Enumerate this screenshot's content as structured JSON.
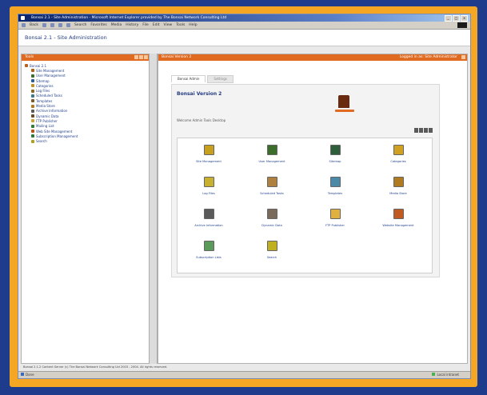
{
  "window": {
    "title": "Bonsai 2.1 - Site Administration - Microsoft Internet Explorer provided by The Bonsai Network Consulting Ltd",
    "controls": [
      "_",
      "□",
      "×"
    ]
  },
  "menubar": {
    "items": [
      "Back",
      "Forward",
      "Stop",
      "Refresh",
      "Home",
      "Search",
      "Favorites",
      "Media",
      "History",
      "File",
      "Edit",
      "View",
      "Favorites",
      "Tools",
      "Help"
    ]
  },
  "page": {
    "heading": "Bonsai 2.1 - Site Administration"
  },
  "left_pane": {
    "title": "Tools",
    "tree": [
      {
        "label": "Bonsai 2.1",
        "level": 0,
        "color": "#c06018"
      },
      {
        "label": "Site Management",
        "level": 1,
        "color": "#b06010"
      },
      {
        "label": "User Management",
        "level": 1,
        "color": "#3a6e2a"
      },
      {
        "label": "Sitemap",
        "level": 1,
        "color": "#2a5e9a"
      },
      {
        "label": "Categories",
        "level": 1,
        "color": "#c09020"
      },
      {
        "label": "Log Files",
        "level": 1,
        "color": "#8a6a20"
      },
      {
        "label": "Scheduled Tasks",
        "level": 1,
        "color": "#3a7a8a"
      },
      {
        "label": "Templates",
        "level": 1,
        "color": "#7a5a2a"
      },
      {
        "label": "Media Store",
        "level": 1,
        "color": "#b07a20"
      },
      {
        "label": "Archive Information",
        "level": 1,
        "color": "#5a5a5a"
      },
      {
        "label": "Dynamic Data",
        "level": 1,
        "color": "#6a4a2a"
      },
      {
        "label": "FTP Publisher",
        "level": 1,
        "color": "#d0a030"
      },
      {
        "label": "Mailing List",
        "level": 1,
        "color": "#2e7d32"
      },
      {
        "label": "Web Site Management",
        "level": 1,
        "color": "#c05010"
      },
      {
        "label": "Subscription Management",
        "level": 1,
        "color": "#2a7a3a"
      },
      {
        "label": "Search",
        "level": 1,
        "color": "#b0a020"
      }
    ]
  },
  "right_pane": {
    "title": "Bonsai Version 2",
    "header_right": "Logged in as: Site Administrator",
    "tabs": [
      "Bonsai Admin",
      "Settings"
    ],
    "card_title": "Bonsai Version 2",
    "card_subtitle": "Welcome Admin Tools Desktop",
    "items": [
      {
        "label": "Site Management",
        "color": "#c8a020"
      },
      {
        "label": "User Management",
        "color": "#3a6e2a"
      },
      {
        "label": "Sitemap",
        "color": "#2e5e3a"
      },
      {
        "label": "Categories",
        "color": "#d0a020"
      },
      {
        "label": "Log Files",
        "color": "#c8b030"
      },
      {
        "label": "Scheduled Tasks",
        "color": "#b08040"
      },
      {
        "label": "Templates",
        "color": "#4a8aa8"
      },
      {
        "label": "Media Store",
        "color": "#b07a20"
      },
      {
        "label": "Archive Information",
        "color": "#5a5a5a"
      },
      {
        "label": "Dynamic Data",
        "color": "#7a6a5a"
      },
      {
        "label": "FTP Publisher",
        "color": "#e0b040"
      },
      {
        "label": "Website Management",
        "color": "#c05a20"
      },
      {
        "label": "Subscription Lists",
        "color": "#5a9a5a"
      },
      {
        "label": "Search",
        "color": "#c0b020"
      }
    ]
  },
  "status_line": "Bonsai 2.1.2 Content Server (c) The Bonsai Network Consulting Ltd 2003 - 2004. All rights reserved.",
  "statusbar": {
    "status": "Done",
    "zone": "Local intranet"
  },
  "colors": {
    "accent": "#e06a20",
    "frame": "#f5a623",
    "background": "#1f3c8c"
  }
}
